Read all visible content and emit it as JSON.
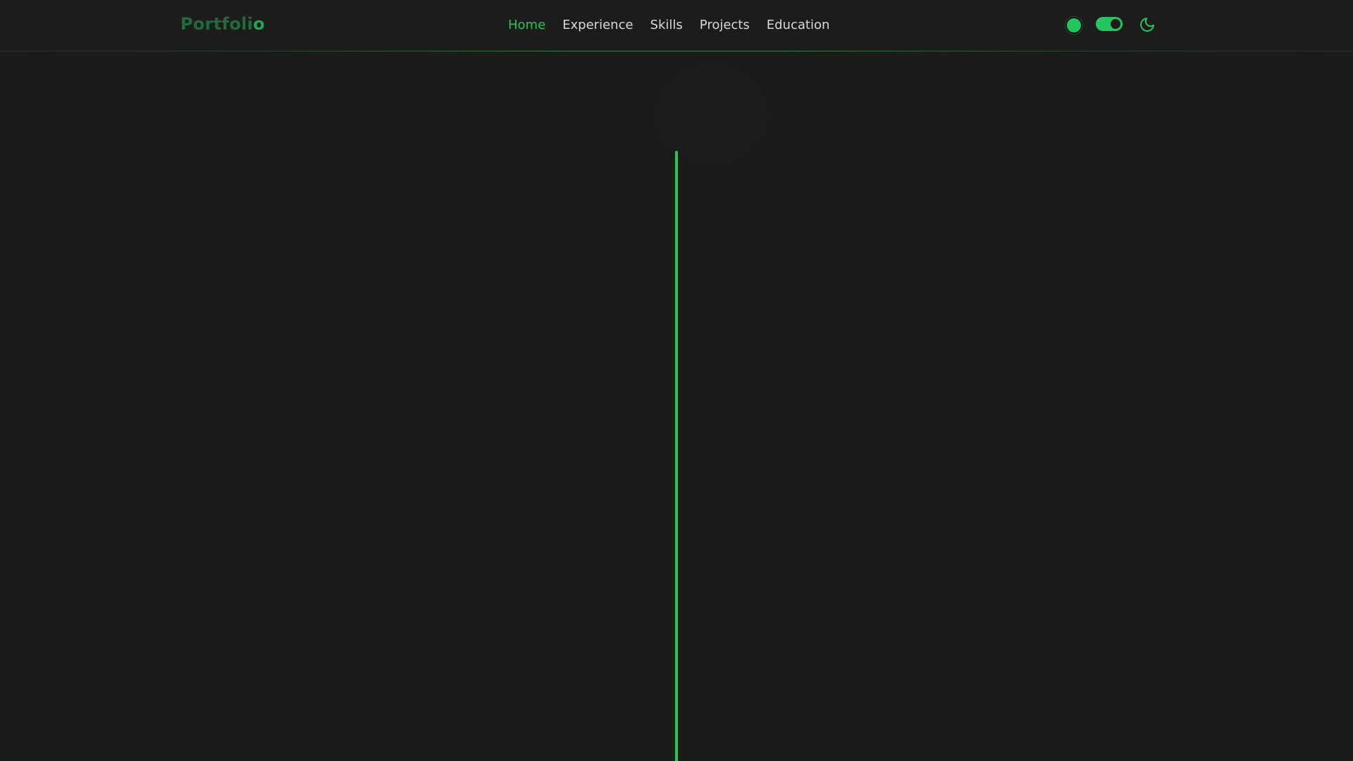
{
  "brand": {
    "text_main": "Portfoli",
    "text_accent": "o"
  },
  "nav": {
    "links": [
      {
        "label": "Home",
        "active": true
      },
      {
        "label": "Experience",
        "active": false
      },
      {
        "label": "Skills",
        "active": false
      },
      {
        "label": "Projects",
        "active": false
      },
      {
        "label": "Education",
        "active": false
      }
    ]
  },
  "controls": {
    "accent_color_swatch": {
      "icon": "color-dot-icon",
      "color": "#22c55e"
    },
    "theme_toggle": {
      "icon": "toggle-switch-icon",
      "on": true
    },
    "dark_mode_button": {
      "icon": "moon-icon"
    }
  },
  "colors": {
    "background": "#1b1b1a",
    "accent": "#22c55e",
    "text": "#d8d8d6",
    "brand_dim": "#1f6b3a"
  }
}
